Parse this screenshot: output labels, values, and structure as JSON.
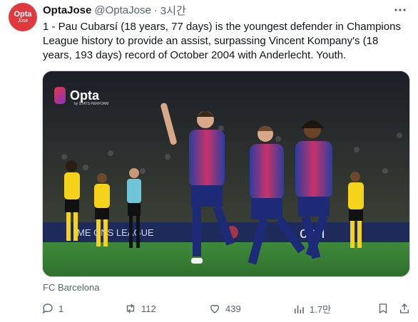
{
  "author": {
    "avatar_line1": "Opta",
    "avatar_line2": "Jose",
    "display_name": "OptaJose",
    "handle": "@OptaJose",
    "separator": "·",
    "time": "3시간"
  },
  "tweet": {
    "text": "1 - Pau Cubarsí (18 years, 77 days) is the youngest defender in Champions League history to provide an assist, surpassing Vincent Kompany's (18 years, 193 days) record of October 2004 with Anderlecht. Youth."
  },
  "media": {
    "logo_text": "Opta",
    "logo_sub": "by STATS PERFORM",
    "board_text_left": "ME ONS LEAGUE",
    "board_text_right": "ceri"
  },
  "caption": "FC Barcelona",
  "actions": {
    "replies": "1",
    "retweets": "112",
    "likes": "439",
    "views": "1.7만"
  },
  "colors": {
    "accent_red": "#e0393e",
    "muted": "#536471",
    "barca_blue": "#2a3ea0",
    "barca_garnet": "#c8326a",
    "bvb_yellow": "#f4d31a"
  }
}
